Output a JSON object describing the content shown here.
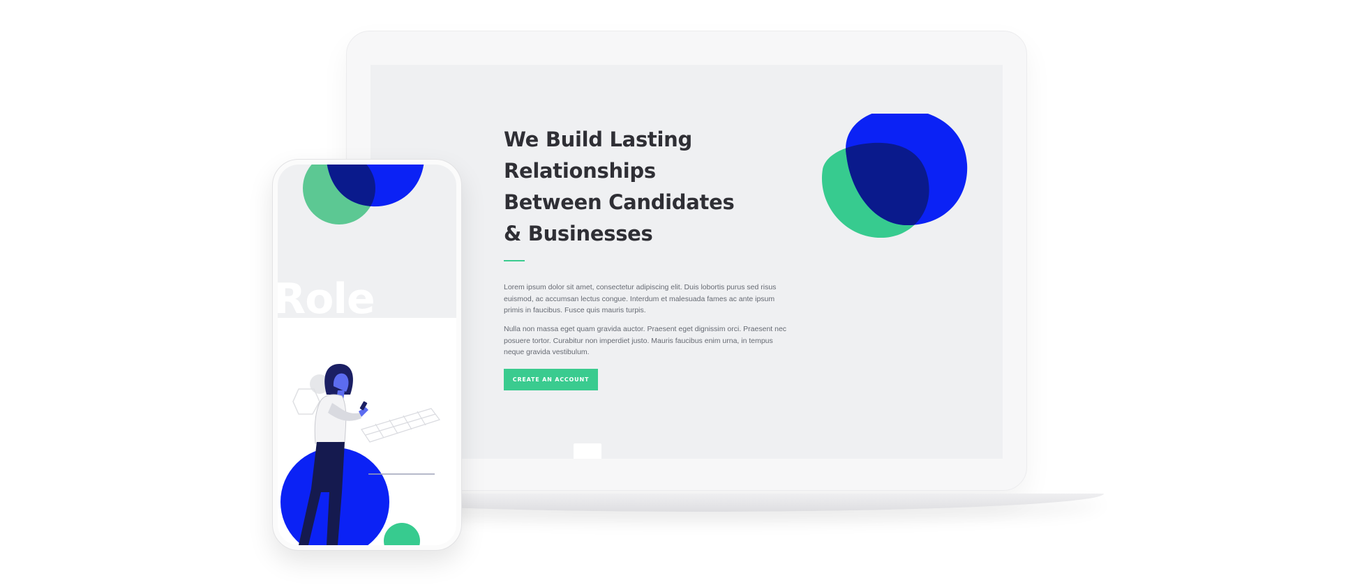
{
  "hero": {
    "heading_lines": [
      "We Build Lasting",
      "Relationships",
      "Between Candidates",
      "& Businesses"
    ],
    "paragraph_1": "Lorem ipsum dolor sit amet, consectetur adipiscing elit. Duis lobortis purus sed risus euismod, ac accumsan lectus congue. Interdum et malesuada fames ac ante ipsum primis in faucibus. Fusce quis mauris turpis.",
    "paragraph_2": "Nulla non massa eget quam gravida auctor. Praesent eget dignissim orci. Praesent nec posuere tortor. Curabitur non imperdiet justo. Mauris faucibus enim urna, in tempus neque gravida vestibulum.",
    "cta_label": "CREATE AN ACCOUNT"
  },
  "phone": {
    "role_text": "Role"
  },
  "colors": {
    "accent_green": "#3acb8f",
    "accent_blue": "#0b22f5",
    "overlap_navy": "#0a1a8c",
    "screen_bg": "#eff0f2",
    "heading": "#2f2f35"
  },
  "icons": {
    "blob_blue": "blue-circle-shape",
    "blob_green": "green-circle-shape",
    "person": "woman-with-phone-illustration"
  }
}
